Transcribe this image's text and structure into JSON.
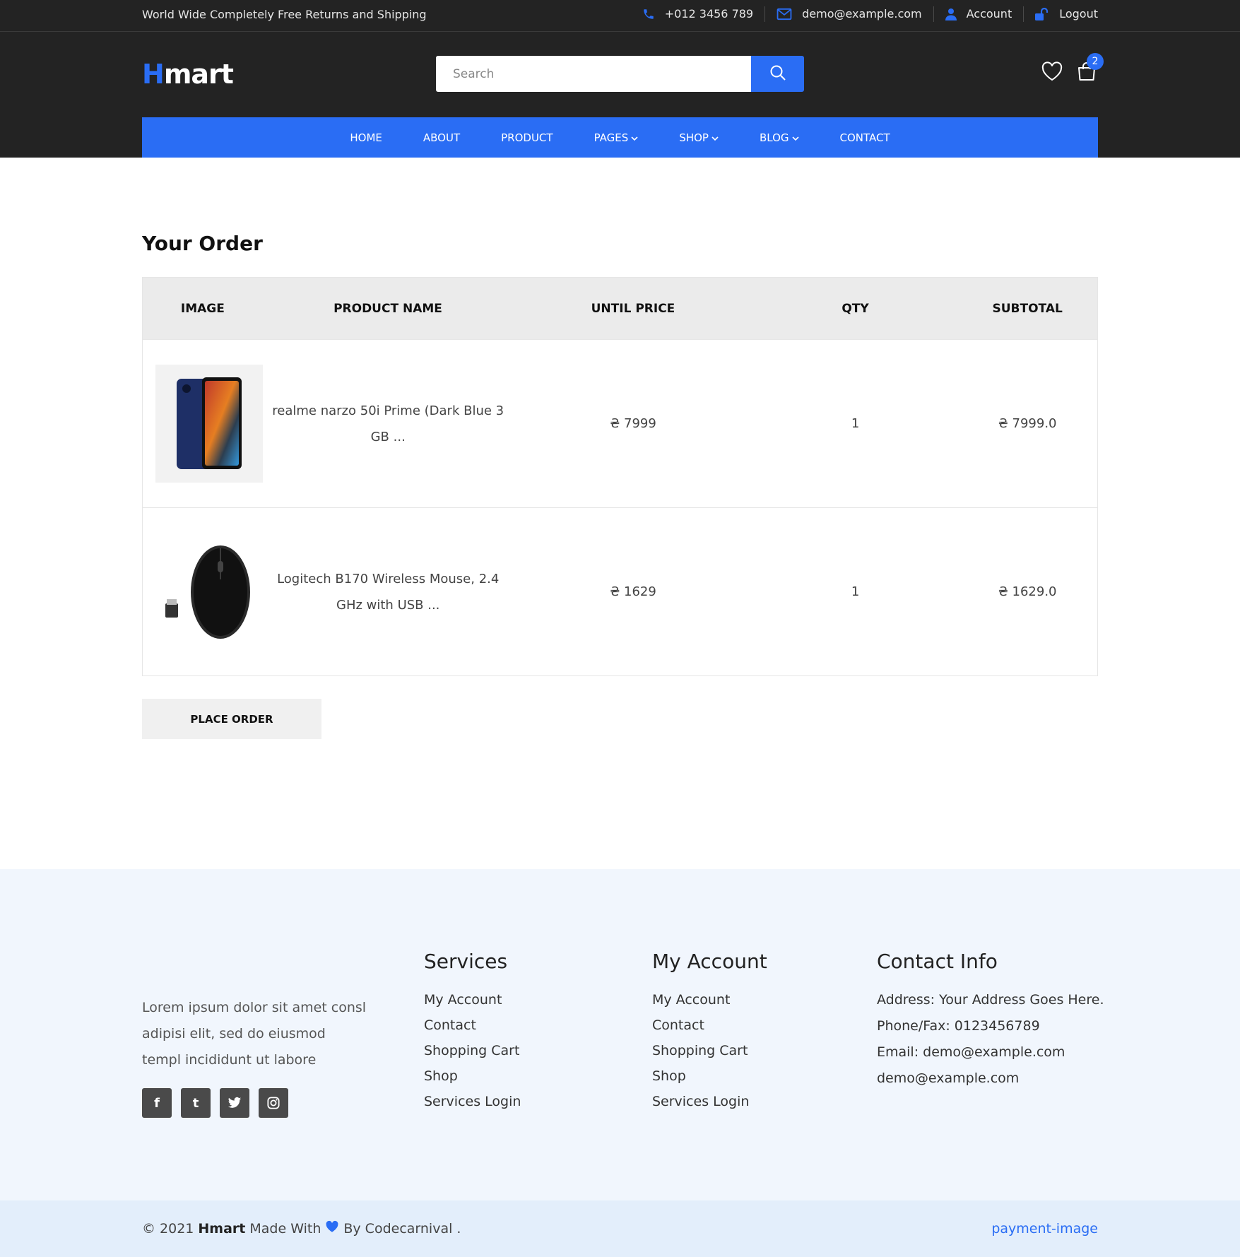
{
  "topbar": {
    "promo": "World Wide Completely Free Returns and Shipping",
    "phone": "+012 3456 789",
    "email": "demo@example.com",
    "account": "Account",
    "logout": "Logout"
  },
  "brand": {
    "logo_first": "H",
    "logo_rest": "mart"
  },
  "search": {
    "placeholder": "Search"
  },
  "cart": {
    "count": "2"
  },
  "nav": {
    "home": "HOME",
    "about": "ABOUT",
    "product": "PRODUCT",
    "pages": "PAGES",
    "shop": "SHOP",
    "blog": "BLOG",
    "contact": "CONTACT"
  },
  "order": {
    "title": "Your Order",
    "headers": {
      "image": "IMAGE",
      "name": "PRODUCT NAME",
      "price": "UNTIL PRICE",
      "qty": "QTY",
      "subtotal": "SUBTOTAL"
    },
    "rows": [
      {
        "name": "realme narzo 50i Prime (Dark Blue 3 GB ...",
        "price": "₴ 7999",
        "qty": "1",
        "subtotal": "₴ 7999.0"
      },
      {
        "name": "Logitech B170 Wireless Mouse, 2.4 GHz with USB ...",
        "price": "₴ 1629",
        "qty": "1",
        "subtotal": "₴ 1629.0"
      }
    ],
    "place_order": "PLACE ORDER"
  },
  "footer": {
    "about": "Lorem ipsum dolor sit amet consl adipisi elit, sed do eiusmod templ incididunt ut labore",
    "services": {
      "title": "Services",
      "items": [
        "My Account",
        "Contact",
        "Shopping Cart",
        "Shop",
        "Services Login"
      ]
    },
    "account": {
      "title": "My Account",
      "items": [
        "My Account",
        "Contact",
        "Shopping Cart",
        "Shop",
        "Services Login"
      ]
    },
    "contact": {
      "title": "Contact Info",
      "address": "Address: Your Address Goes Here.",
      "phone": "Phone/Fax: 0123456789",
      "email": "Email: demo@example.com",
      "email2": "demo@example.com"
    },
    "socials": {
      "facebook": "f",
      "tumblr": "t"
    },
    "copyright": {
      "prefix": "© 2021",
      "brand": "Hmart",
      "made": "Made With",
      "by": "By Codecarnival ."
    },
    "payment_alt": "payment-image"
  },
  "colors": {
    "accent": "#2a6df4",
    "dark": "#232323",
    "footer_bg": "#f1f6fd",
    "copy_bg": "#e3eefb"
  }
}
